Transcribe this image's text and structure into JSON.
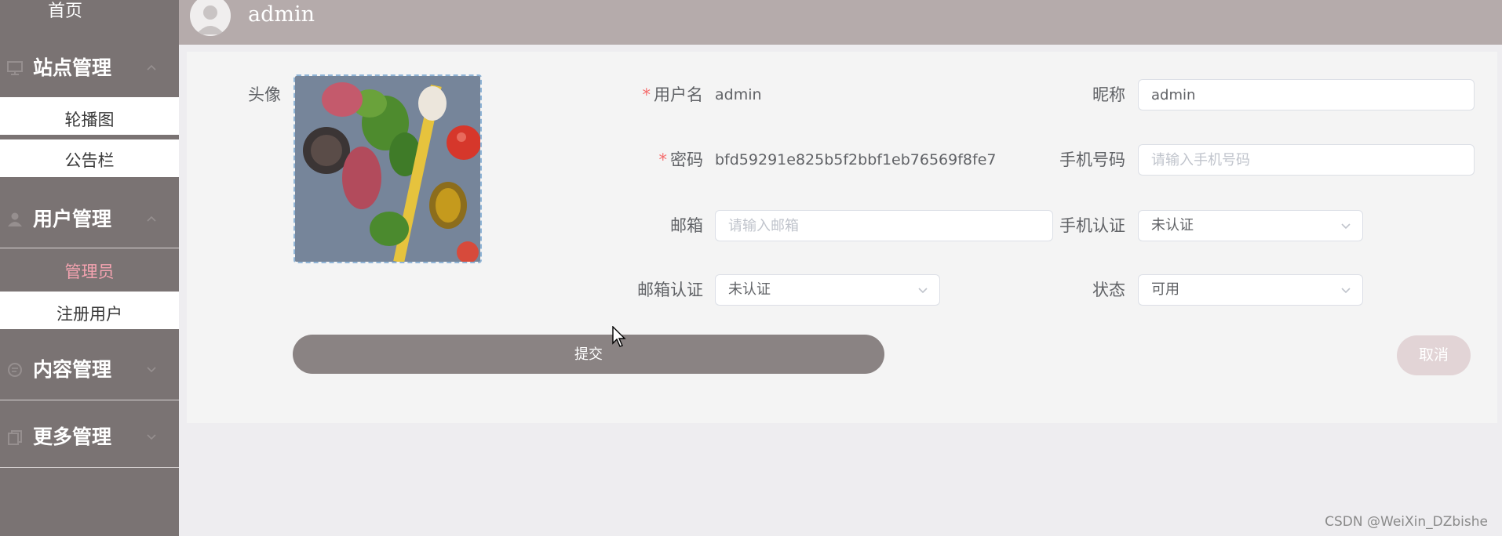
{
  "sidebar": {
    "home": "首页",
    "groups": [
      {
        "label": "站点管理",
        "icon": "monitor-icon"
      },
      {
        "label": "用户管理",
        "icon": "user-icon"
      },
      {
        "label": "内容管理",
        "icon": "chat-icon"
      },
      {
        "label": "更多管理",
        "icon": "copy-icon"
      }
    ],
    "site_items": [
      "轮播图",
      "公告栏"
    ],
    "user_items": [
      "管理员",
      "注册用户"
    ]
  },
  "header": {
    "title": "admin"
  },
  "form": {
    "avatar_label": "头像",
    "username_label": "用户名",
    "username_value": "admin",
    "password_label": "密码",
    "password_value": "bfd59291e825b5f2bbf1eb76569f8fe7",
    "email_label": "邮箱",
    "email_placeholder": "请输入邮箱",
    "email_verify_label": "邮箱认证",
    "email_verify_value": "未认证",
    "nickname_label": "昵称",
    "nickname_value": "admin",
    "phone_label": "手机号码",
    "phone_placeholder": "请输入手机号码",
    "phone_verify_label": "手机认证",
    "phone_verify_value": "未认证",
    "status_label": "状态",
    "status_value": "可用",
    "submit_label": "提交",
    "cancel_label": "取消"
  },
  "watermark": "CSDN @WeiXin_DZbishe",
  "colors": {
    "sidebar_bg": "#7a7373",
    "header_bg": "#b5abab",
    "active_item": "#f4a3b0",
    "submit_bg": "#8a8383",
    "cancel_bg": "#e2d4d6",
    "required": "#f56c6c"
  }
}
